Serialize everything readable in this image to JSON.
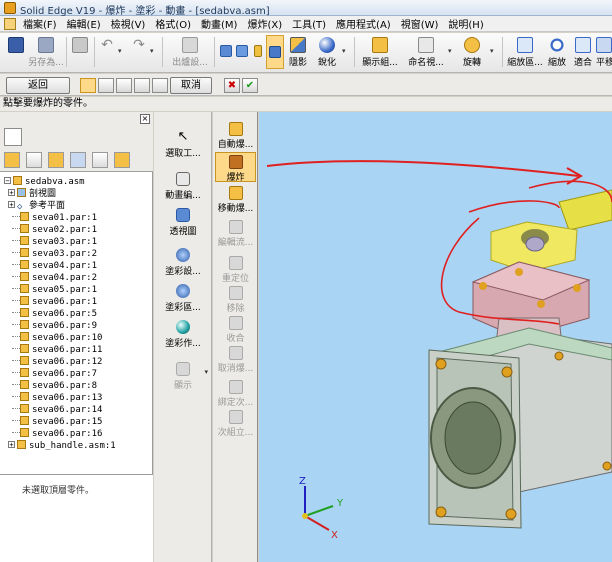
{
  "window": {
    "title": "Solid Edge V19 - 爆炸 - 塗彩 - 動畫 - [sedabva.asm]"
  },
  "menu": [
    "檔案(F)",
    "編輯(E)",
    "檢視(V)",
    "格式(O)",
    "動畫(M)",
    "爆炸(X)",
    "工具(T)",
    "應用程式(A)",
    "視窗(W)",
    "說明(H)"
  ],
  "toolbar": {
    "save_as": "另存為...",
    "export": "出爐設...",
    "hidden": "隱影",
    "sharpen": "銳化",
    "display": "顯示組...",
    "rename": "命名視...",
    "rotate": "旋轉",
    "zoom_area": "縮放區...",
    "zoom": "縮放",
    "fit": "適合",
    "pan": "平移"
  },
  "cmdbar": {
    "back": "返回",
    "cancel": "取消",
    "check": "✔",
    "close": "✖"
  },
  "prompt": "點擊要爆炸的零件。",
  "tree": {
    "root": "sedabva.asm",
    "items": [
      {
        "label": "剖視圖",
        "type": "view"
      },
      {
        "label": "參考平面",
        "type": "plane"
      },
      {
        "label": "seva01.par:1",
        "type": "part"
      },
      {
        "label": "seva02.par:1",
        "type": "part"
      },
      {
        "label": "seva03.par:1",
        "type": "part"
      },
      {
        "label": "seva03.par:2",
        "type": "part"
      },
      {
        "label": "seva04.par:1",
        "type": "part"
      },
      {
        "label": "seva04.par:2",
        "type": "part"
      },
      {
        "label": "seva05.par:1",
        "type": "part"
      },
      {
        "label": "seva06.par:1",
        "type": "part"
      },
      {
        "label": "seva06.par:5",
        "type": "part"
      },
      {
        "label": "seva06.par:9",
        "type": "part"
      },
      {
        "label": "seva06.par:10",
        "type": "part"
      },
      {
        "label": "seva06.par:11",
        "type": "part"
      },
      {
        "label": "seva06.par:12",
        "type": "part"
      },
      {
        "label": "seva06.par:7",
        "type": "part"
      },
      {
        "label": "seva06.par:8",
        "type": "part"
      },
      {
        "label": "seva06.par:13",
        "type": "part"
      },
      {
        "label": "seva06.par:14",
        "type": "part"
      },
      {
        "label": "seva06.par:15",
        "type": "part"
      },
      {
        "label": "seva06.par:16",
        "type": "part"
      },
      {
        "label": "sub_handle.asm:1",
        "type": "asm"
      }
    ],
    "status": "未選取頂層零件。"
  },
  "col2": {
    "select": "選取工...",
    "move_edit": "動畫編...",
    "perspective": "透視圖",
    "render_set": "塗彩設...",
    "render_area": "塗彩區...",
    "render_work": "塗彩作...",
    "show": "顯示"
  },
  "col3": {
    "auto_explode": "自動爆...",
    "explode": "爆炸",
    "move_explode": "移動爆...",
    "edit_flow": "編輯流...",
    "reposition": "重定位",
    "remove": "移除",
    "collapse": "收合",
    "cancel_explode": "取消爆...",
    "bind": "綁定次...",
    "unbind": "次組立..."
  },
  "axes": {
    "x": "X",
    "y": "Y",
    "z": "Z"
  },
  "colors": {
    "viewport_bg": "#a9d4f3",
    "annotation_red": "#e02020",
    "handle_yellow": "#e6e046"
  }
}
